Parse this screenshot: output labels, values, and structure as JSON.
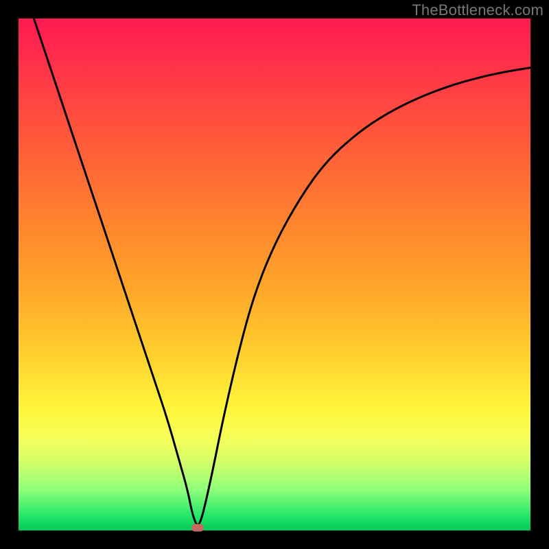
{
  "watermark": "TheBottleneck.com",
  "chart_data": {
    "type": "line",
    "title": "",
    "xlabel": "",
    "ylabel": "",
    "xlim": [
      0,
      100
    ],
    "ylim": [
      0,
      100
    ],
    "grid": false,
    "series": [
      {
        "name": "curve",
        "x": [
          3,
          6,
          10,
          14,
          18,
          22,
          26,
          29,
          31,
          33,
          34,
          35,
          36,
          38,
          40,
          43,
          46,
          50,
          55,
          60,
          66,
          72,
          78,
          84,
          90,
          95,
          100
        ],
        "y": [
          100,
          91,
          79,
          67,
          55,
          43,
          31,
          22,
          15,
          8,
          3,
          0.5,
          3,
          12,
          22,
          35,
          46,
          56,
          65,
          72,
          77.5,
          81.5,
          84.5,
          86.8,
          88.5,
          89.6,
          90.4
        ]
      }
    ],
    "marker": {
      "x": 35,
      "y": 0.5,
      "color": "#c76a62"
    },
    "background_gradient": {
      "top": "#ff1a52",
      "mid": "#ffd12e",
      "bottom": "#00c85a"
    }
  }
}
